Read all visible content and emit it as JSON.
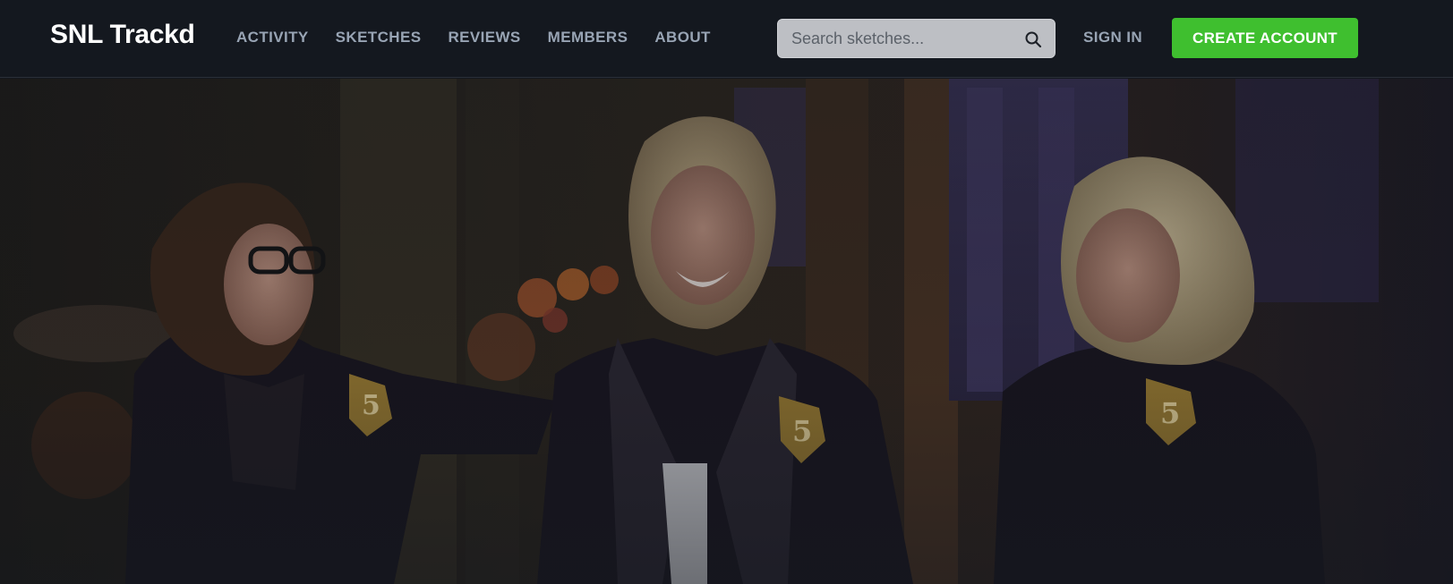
{
  "header": {
    "brand": "SNL Trackd",
    "nav": [
      {
        "label": "ACTIVITY"
      },
      {
        "label": "SKETCHES"
      },
      {
        "label": "REVIEWS"
      },
      {
        "label": "MEMBERS"
      },
      {
        "label": "ABOUT"
      }
    ],
    "search": {
      "placeholder": "Search sketches...",
      "value": "",
      "icon": "search-icon"
    },
    "sign_in": "SIGN IN",
    "create_account": "CREATE ACCOUNT"
  },
  "hero": {
    "badge_text": "5"
  },
  "colors": {
    "background": "#14181f",
    "nav_text": "#98a4b4",
    "brand_text": "#ffffff",
    "accent_green": "#3fbf2f",
    "search_bg": "#bdbfc4"
  }
}
